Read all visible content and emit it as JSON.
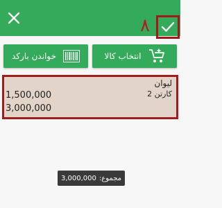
{
  "header": {
    "close_icon": "close-icon",
    "confirm_icon": "checkmark-icon",
    "step_number": "۸",
    "colors": {
      "bar": "#33ab5a",
      "highlight": "#a11a1a"
    }
  },
  "toolbar": {
    "barcode_label": "خواندن بارکد",
    "barcode_icon": "barcode-icon",
    "select_label": "انتخاب کالا",
    "select_icon": "cart-add-icon"
  },
  "items": [
    {
      "name": "ليوان",
      "quantity": "2 کارتن",
      "price": "1,500,000",
      "total": "3,000,000"
    }
  ],
  "toast": {
    "label": "مجموع:",
    "value": "3,000,000"
  }
}
